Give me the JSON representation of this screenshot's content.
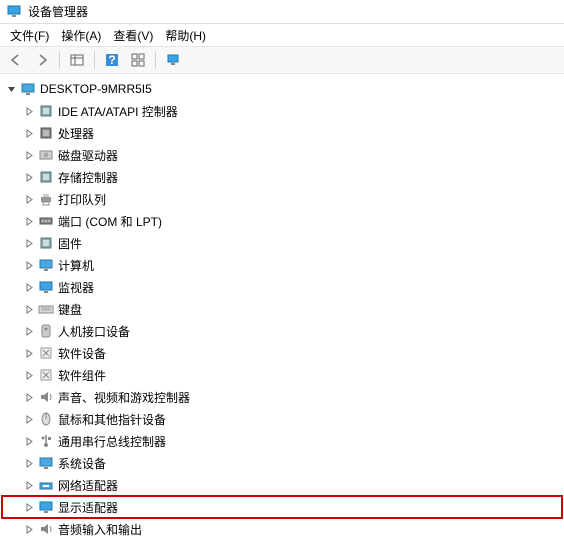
{
  "window": {
    "title": "设备管理器"
  },
  "menu": {
    "file": "文件(F)",
    "action": "操作(A)",
    "view": "查看(V)",
    "help": "帮助(H)"
  },
  "root": {
    "name": "DESKTOP-9MRR5I5"
  },
  "categories": [
    {
      "id": "ide",
      "label": "IDE ATA/ATAPI 控制器",
      "icon": "chip",
      "highlight": false
    },
    {
      "id": "cpu",
      "label": "处理器",
      "icon": "cpu",
      "highlight": false
    },
    {
      "id": "disk",
      "label": "磁盘驱动器",
      "icon": "disk",
      "highlight": false
    },
    {
      "id": "storage",
      "label": "存储控制器",
      "icon": "chip",
      "highlight": false
    },
    {
      "id": "printq",
      "label": "打印队列",
      "icon": "printer",
      "highlight": false
    },
    {
      "id": "ports",
      "label": "端口 (COM 和 LPT)",
      "icon": "port",
      "highlight": false
    },
    {
      "id": "firmware",
      "label": "固件",
      "icon": "chip",
      "highlight": false
    },
    {
      "id": "computer",
      "label": "计算机",
      "icon": "computer",
      "highlight": false
    },
    {
      "id": "monitor",
      "label": "监视器",
      "icon": "monitor",
      "highlight": false
    },
    {
      "id": "keyboard",
      "label": "键盘",
      "icon": "keyboard",
      "highlight": false
    },
    {
      "id": "hid",
      "label": "人机接口设备",
      "icon": "hid",
      "highlight": false
    },
    {
      "id": "swdev",
      "label": "软件设备",
      "icon": "soft",
      "highlight": false
    },
    {
      "id": "swcomp",
      "label": "软件组件",
      "icon": "soft",
      "highlight": false
    },
    {
      "id": "sound",
      "label": "声音、视频和游戏控制器",
      "icon": "speaker",
      "highlight": false
    },
    {
      "id": "mouse",
      "label": "鼠标和其他指针设备",
      "icon": "mouse",
      "highlight": false
    },
    {
      "id": "usb",
      "label": "通用串行总线控制器",
      "icon": "usb",
      "highlight": false
    },
    {
      "id": "system",
      "label": "系统设备",
      "icon": "computer",
      "highlight": false
    },
    {
      "id": "network",
      "label": "网络适配器",
      "icon": "network",
      "highlight": false
    },
    {
      "id": "display",
      "label": "显示适配器",
      "icon": "monitor",
      "highlight": true
    },
    {
      "id": "audio",
      "label": "音频输入和输出",
      "icon": "speaker",
      "highlight": false
    }
  ]
}
